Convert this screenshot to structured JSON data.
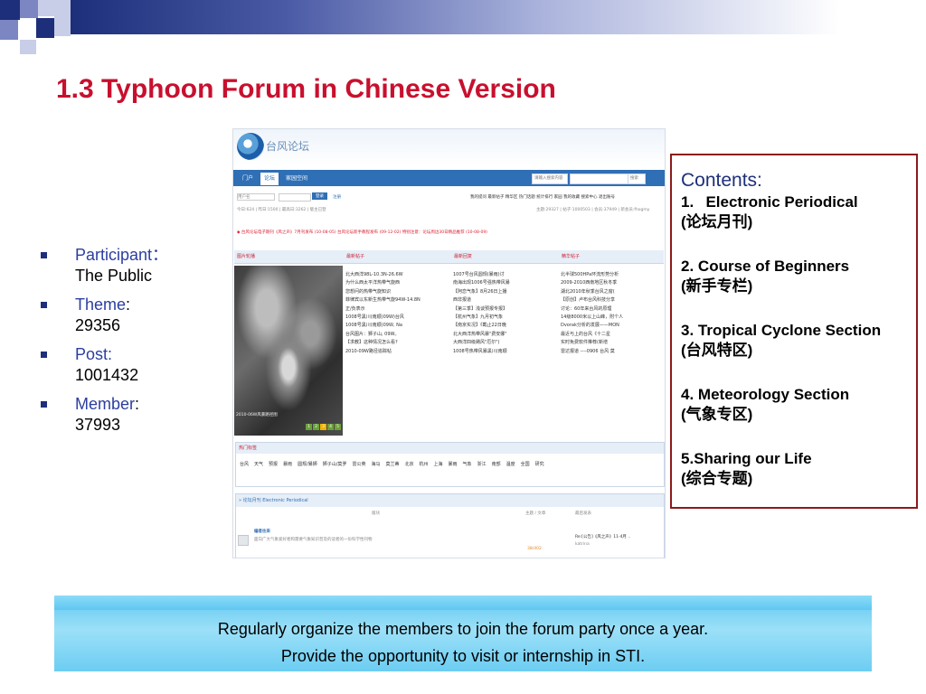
{
  "slide": {
    "title": "1.3 Typhoon Forum in Chinese Version",
    "bullets": [
      {
        "key": "Participant",
        "sep": "：",
        "value": "The Public"
      },
      {
        "key": "Theme",
        "sep": ":",
        "value": "29356"
      },
      {
        "key": "Post",
        "sep": ":",
        "value": "1001432"
      },
      {
        "key": "Member",
        "sep": ":",
        "value": "37993"
      }
    ],
    "contents": {
      "title": "Contents:",
      "items": [
        {
          "num": "1.",
          "label": "Electronic Periodical",
          "cn": "(论坛月刊)"
        },
        {
          "num": "2.",
          "label": "Course of Beginners",
          "cn": "(新手专栏)"
        },
        {
          "num": "3.",
          "label": "Tropical Cyclone Section",
          "cn": "(台风特区)"
        },
        {
          "num": "4.",
          "label": "Meteorology Section",
          "cn": "(气象专区)"
        },
        {
          "num": "5.",
          "label": "Sharing our Life",
          "cn": "(综合专题)"
        }
      ]
    },
    "banner": {
      "line1": "Regularly organize the members to join the forum party once a year.",
      "line2": "Provide the opportunity to visit or internship in STI."
    },
    "colors": {
      "title": "#c8102e",
      "accent": "#1d2f7a",
      "box_border": "#8b1a1a",
      "banner": "#7fd6f5"
    }
  },
  "forum": {
    "logo_text": "台风论坛",
    "nav": [
      "门户",
      "论坛",
      "家园空间"
    ],
    "search_placeholder": "请输入搜索内容",
    "search_button": "搜索",
    "login": {
      "user_placeholder": "用户名",
      "button": "登录",
      "register": "注册"
    },
    "quick_links": "我的提问 最新帖子 精华区 热门话题 统计排行 家园 我的收藏 搜索中心 退出账号",
    "stats": "今日:624 | 昨日:1500 | 最高日:3262 | 版主已登",
    "stats_right": "主题:29327 | 帖子:1000503 | 会员:37949 | 新会员:fhogmy",
    "notice": "◆ 台风论坛电子期刊《风之声》7月刊发布 (10-08-05)   台风论坛新手教程发布 (09-12-02)   特别注意：论坛周边30日精品推荐 (10-08-09)",
    "panels": [
      "图片轮播",
      "最新帖子",
      "最新回复",
      "精华帖子"
    ],
    "photo_caption": "2010-06W风暴路径图",
    "photo_nums": [
      "1",
      "2",
      "3",
      "4",
      "5"
    ],
    "col_new": [
      "北大西洋98L-10.3N-26.6W",
      "为什么西太平洋热带气旋西",
      "您想问的热带气旋知识",
      "菲律宾以东新生热带气旋94W-14.8N",
      "正/负表示",
      "1008号黑川(南顺)09W)台风",
      "1008号黑川(南顺)09W, Na",
      "台风图片：狮子山, 09W。",
      "【求教】这种情况怎么看?",
      "2010-09W路径追踪帖"
    ],
    "col_reply": [
      "1007号台风圆规(暴雨)讨",
      "南海出现1006号强热带风暴",
      "【阿恋气象】8月26日上播",
      "西非报道",
      "【第三季】浅谈预报专报】",
      "【杭州气象】九月初气象",
      "【南京实况】《截止22日晚",
      "北大西洋热带风暴\"费安娜\"",
      "大西洋四级飓风\"厄尔\"(",
      "1008号热带风暴黑川(南顺"
    ],
    "col_best": [
      "北半球500HPa环流形势分析",
      "2009-2010西南地区秋冬季",
      "湖北2010年秋季台风之窗(",
      "【原创】卢布台风科技分享",
      "讨论：60年来台风的原理",
      "14级8000米以上山峰，附个人",
      "Dvorak分析的发展——MON",
      "最近与上的台风《十二星",
      "实时免费软件推荐(新增",
      "雷达报道 ----0906 台风 莫"
    ],
    "hot": {
      "header": "热门标签",
      "tags": [
        "台风",
        "天气",
        "预报",
        "暴雨",
        "圆规/暴狮",
        "狮子山/莫罗",
        "雷公英",
        "海马",
        "莫兰蒂",
        "北京",
        "杭州",
        "上海",
        "暴雨",
        "气象",
        "浙江",
        "南部",
        "温度",
        "全国",
        "研究"
      ]
    },
    "periodical": {
      "header": "» 论坛月刊 Electronic Periodical",
      "columns": [
        "版块",
        "主题 / 文章",
        "最后发表"
      ],
      "row_title": "编者往来",
      "row_desc": "面向广大气象爱好者和需要气象知识普及的读者的一份科学性刊物",
      "row_counts": "38/402",
      "row_last": "Re:[公告]《风之声》11-4月 ..",
      "row_user": "katrina"
    }
  }
}
